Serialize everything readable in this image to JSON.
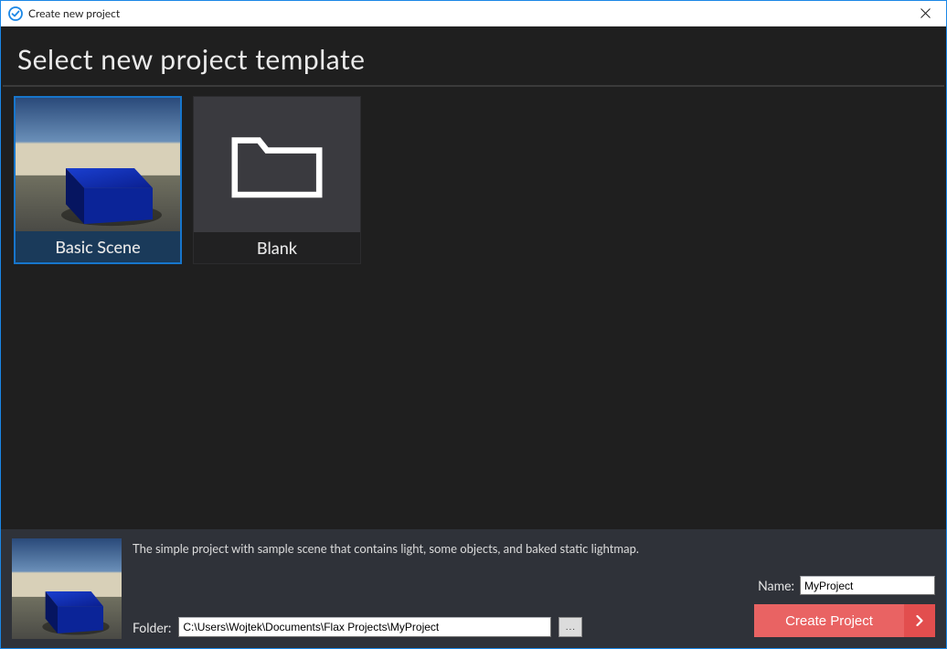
{
  "window": {
    "title": "Create new project"
  },
  "header": {
    "title": "Select new project template"
  },
  "templates": [
    {
      "id": "basic-scene",
      "label": "Basic Scene",
      "selected": true
    },
    {
      "id": "blank",
      "label": "Blank",
      "selected": false
    }
  ],
  "selected_template": {
    "description": "The simple project with sample scene that contains light, some objects, and baked static lightmap."
  },
  "footer": {
    "folder_label": "Folder:",
    "folder_value": "C:\\Users\\Wojtek\\Documents\\Flax Projects\\MyProject",
    "browse_label": "...",
    "name_label": "Name:",
    "name_value": "MyProject",
    "create_label": "Create Project"
  },
  "colors": {
    "accent_blue": "#1776cc",
    "accent_red": "#e96363",
    "bg_dark": "#1f1f1f",
    "bg_panel": "#2f3239"
  }
}
